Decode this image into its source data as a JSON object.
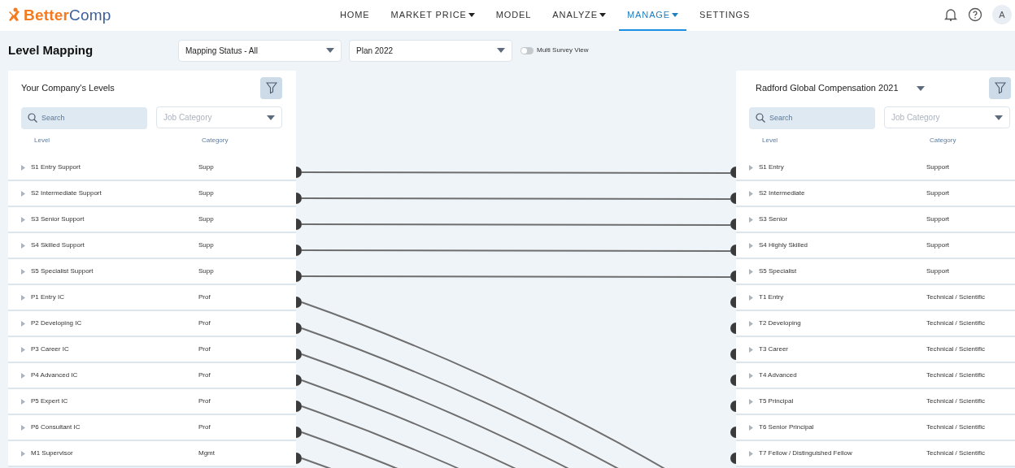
{
  "nav": {
    "brand_first": "Better",
    "brand_second": "Comp",
    "items": [
      {
        "label": "HOME",
        "dropdown": false,
        "selected": false
      },
      {
        "label": "MARKET PRICE",
        "dropdown": true,
        "selected": false
      },
      {
        "label": "MODEL",
        "dropdown": false,
        "selected": false
      },
      {
        "label": "ANALYZE",
        "dropdown": true,
        "selected": false
      },
      {
        "label": "MANAGE",
        "dropdown": true,
        "selected": true
      },
      {
        "label": "SETTINGS",
        "dropdown": false,
        "selected": false
      }
    ],
    "avatar": "A"
  },
  "page_title": "Level Mapping",
  "mapping_status": {
    "value": "Mapping Status - All"
  },
  "plan": {
    "value": "Plan 2022"
  },
  "multi_survey_toggle": {
    "label": "Multi Survey View",
    "on": false
  },
  "left_panel": {
    "title": "Your Company's Levels",
    "search": {
      "placeholder": "Search"
    },
    "category_filter": {
      "placeholder": "Job Category"
    },
    "columns": [
      "Level",
      "Category"
    ],
    "rows": [
      {
        "level": "S1 Entry Support",
        "category": "Supp",
        "expanded": false,
        "kind": "across"
      },
      {
        "level": "S2 Intermediate Support",
        "category": "Supp",
        "expanded": false,
        "kind": "across"
      },
      {
        "level": "S3 Senior Support",
        "category": "Supp",
        "expanded": false,
        "kind": "across"
      },
      {
        "level": "S4 Skilled Support",
        "category": "Supp",
        "expanded": false,
        "kind": "across"
      },
      {
        "level": "S5 Specialist Support",
        "category": "Supp",
        "expanded": false,
        "kind": "across"
      },
      {
        "level": "P1 Entry IC",
        "category": "Prof",
        "expanded": false,
        "kind": "down"
      },
      {
        "level": "P2 Developing IC",
        "category": "Prof",
        "expanded": false,
        "kind": "down"
      },
      {
        "level": "P3 Career IC",
        "category": "Prof",
        "expanded": false,
        "kind": "down"
      },
      {
        "level": "P4 Advanced IC",
        "category": "Prof",
        "expanded": false,
        "kind": "down"
      },
      {
        "level": "P5 Expert IC",
        "category": "Prof",
        "expanded": false,
        "kind": "down"
      },
      {
        "level": "P6 Consultant IC",
        "category": "Prof",
        "expanded": false,
        "kind": "down"
      },
      {
        "level": "M1 Supervisor",
        "category": "Mgmt",
        "expanded": false,
        "kind": "down"
      }
    ]
  },
  "right_panel": {
    "survey": "Radford Global Compensation 2021",
    "search": {
      "placeholder": "Search"
    },
    "category_filter": {
      "placeholder": "Job Category"
    },
    "columns": [
      "Level",
      "Category"
    ],
    "rows": [
      {
        "level": "S1 Entry",
        "category": "Support",
        "expanded": false
      },
      {
        "level": "S2 Intermediate",
        "category": "Support",
        "expanded": false
      },
      {
        "level": "S3 Senior",
        "category": "Support",
        "expanded": false
      },
      {
        "level": "S4 Highly Skilled",
        "category": "Support",
        "expanded": false
      },
      {
        "level": "S5 Specialist",
        "category": "Support",
        "expanded": false
      },
      {
        "level": "T1 Entry",
        "category": "Technical / Scientific",
        "expanded": false
      },
      {
        "level": "T2 Developing",
        "category": "Technical / Scientific",
        "expanded": false
      },
      {
        "level": "T3 Career",
        "category": "Technical / Scientific",
        "expanded": false
      },
      {
        "level": "T4 Advanced",
        "category": "Technical / Scientific",
        "expanded": false
      },
      {
        "level": "T5 Principal",
        "category": "Technical / Scientific",
        "expanded": false
      },
      {
        "level": "T6 Senior Principal",
        "category": "Technical / Scientific",
        "expanded": false
      },
      {
        "level": "T7 Fellow / Distinguished Fellow",
        "category": "Technical / Scientific",
        "expanded": false
      }
    ]
  }
}
